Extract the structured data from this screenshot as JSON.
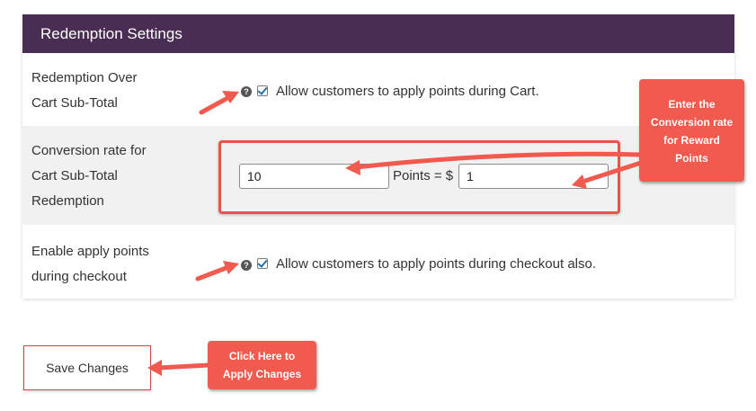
{
  "panel": {
    "title": "Redemption Settings"
  },
  "rows": {
    "cart_redemption": {
      "label_line1": "Redemption Over",
      "label_line2": "Cart Sub-Total",
      "help": "?",
      "checked": true,
      "checkbox_label": "Allow customers to apply points during Cart."
    },
    "conversion": {
      "label_line1": "Conversion rate for",
      "label_line2": "Cart Sub-Total",
      "label_line3": "Redemption",
      "points_value": "10",
      "points_label": "Points = $",
      "dollar_value": "1"
    },
    "checkout": {
      "label_line1": "Enable apply points",
      "label_line2": "during checkout",
      "help": "?",
      "checked": true,
      "checkbox_label": "Allow customers to apply points during checkout also."
    }
  },
  "callouts": {
    "conversion": {
      "line1": "Enter the",
      "line2": "Conversion rate",
      "line3": "for Reward",
      "line4": "Points"
    },
    "save": {
      "line1": "Click Here to",
      "line2": "Apply Changes"
    }
  },
  "buttons": {
    "save_label": "Save Changes"
  },
  "colors": {
    "header_bg": "#4a2d53",
    "annotation": "#f05a4f",
    "checkbox_accent": "#2271b1"
  }
}
